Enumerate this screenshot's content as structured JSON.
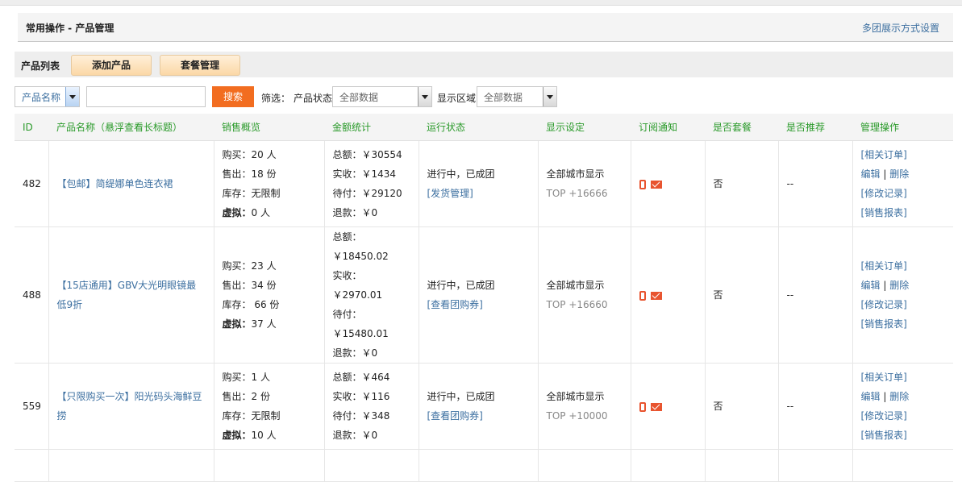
{
  "header": {
    "title": "常用操作 - 产品管理",
    "display_settings_link": "多团展示方式设置"
  },
  "toolbar": {
    "list_label": "产品列表",
    "add_product": "添加产品",
    "package_manage": "套餐管理"
  },
  "filter": {
    "search_field_select": "产品名称",
    "search_value": "",
    "search_button": "搜索",
    "filter_label": "筛选：",
    "status_label": "产品状态",
    "status_value": "全部数据",
    "area_label": "显示区域",
    "area_value": "全部数据"
  },
  "table": {
    "headers": [
      "ID",
      "产品名称（悬浮查看长标题）",
      "销售概览",
      "金额统计",
      "运行状态",
      "显示设定",
      "订阅通知",
      "是否套餐",
      "是否推荐",
      "管理操作"
    ],
    "rows": [
      {
        "id": "482",
        "name": "【包邮】简缇娜单色连衣裙",
        "sales": [
          "购买：20 人",
          "售出：18 份",
          "库存：无限制",
          "0 人"
        ],
        "amounts": [
          "总额：￥30554",
          "实收：￥1434",
          "待付：￥29120",
          "退款：￥0"
        ],
        "status": "进行中，已成团",
        "status_link": "[发货管理]",
        "display": "全部城市显示",
        "top": "TOP +16666",
        "package": "否",
        "recommend": "--",
        "actions": [
          "[相关订单]",
          "编辑",
          "删除",
          "[修改记录]",
          "[销售报表]"
        ]
      },
      {
        "id": "488",
        "name": "【15店通用】GBV大光明眼镜最低9折",
        "sales": [
          "购买：23 人",
          "售出：34 份",
          "库存： 66 份",
          "37 人"
        ],
        "amounts": [
          "总额：",
          "￥18450.02",
          "实收：￥2970.01",
          "待付：",
          "￥15480.01",
          "退款：￥0"
        ],
        "status": "进行中，已成团",
        "status_link": "[查看团购券]",
        "display": "全部城市显示",
        "top": "TOP +16660",
        "package": "否",
        "recommend": "--",
        "actions": [
          "[相关订单]",
          "编辑",
          "删除",
          "[修改记录]",
          "[销售报表]"
        ]
      },
      {
        "id": "559",
        "name": "【只限购买一次】阳光码头海鲜豆捞",
        "sales": [
          "购买：1 人",
          "售出：2 份",
          "库存：无限制",
          "10 人"
        ],
        "amounts": [
          "总额：￥464",
          "实收：￥116",
          "待付：￥348",
          "退款：￥0"
        ],
        "status": "进行中，已成团",
        "status_link": "[查看团购券]",
        "display": "全部城市显示",
        "top": "TOP +10000",
        "package": "否",
        "recommend": "--",
        "actions": [
          "[相关订单]",
          "编辑",
          "删除",
          "[修改记录]",
          "[销售报表]"
        ]
      }
    ],
    "virtual_label": "虚拟：",
    "action_separator": "|"
  },
  "icons": {
    "phone": "phone-icon",
    "mail": "mail-icon"
  },
  "colors": {
    "accent_green": "#2a9a2a",
    "link_blue": "#3c6fa0",
    "search_orange": "#f26d20",
    "icon_red": "#e8542f"
  }
}
